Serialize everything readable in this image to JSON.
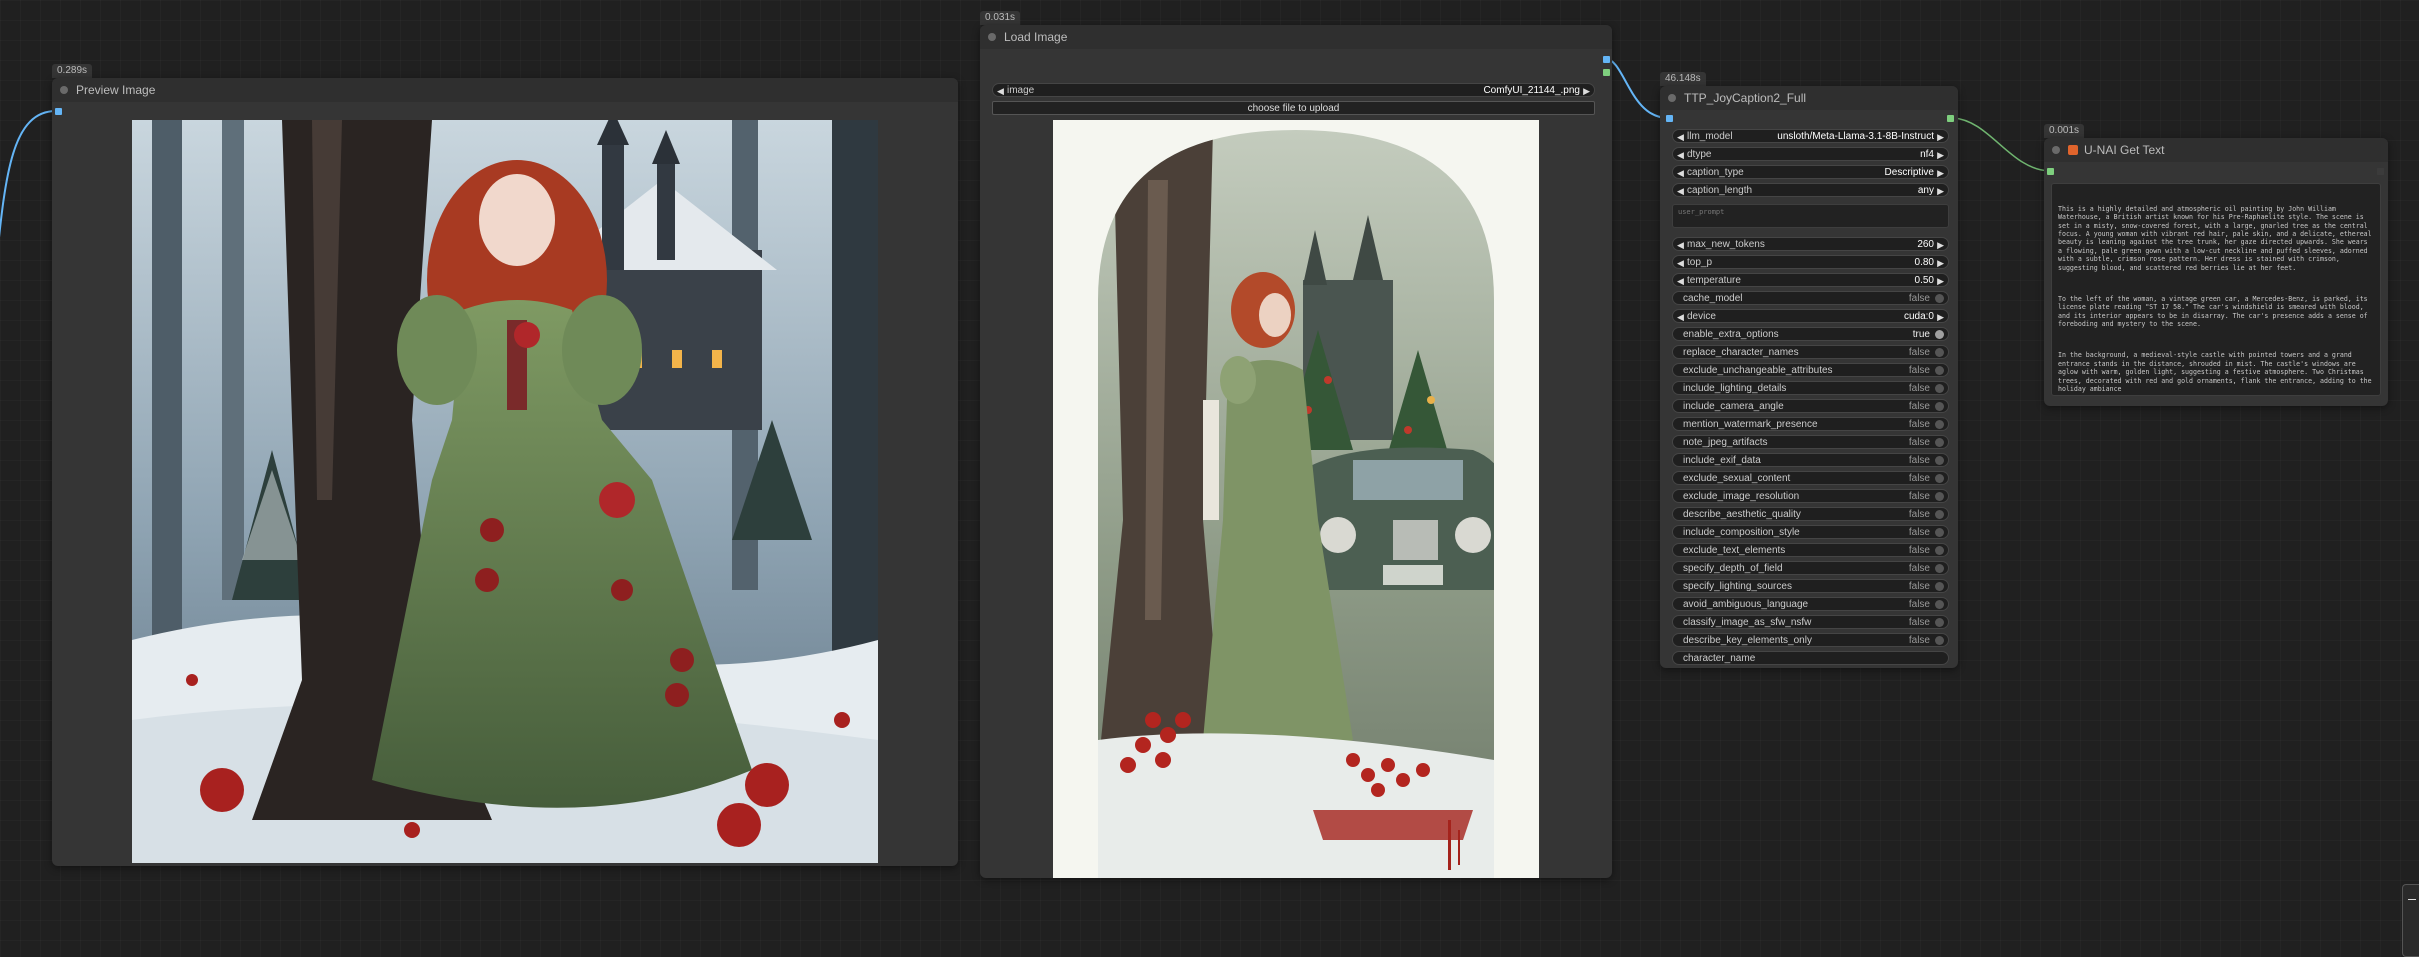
{
  "colors": {
    "canvas": "#202020",
    "node_bg": "#353535",
    "wire_image": "#64b5f6",
    "wire_string": "#7ecf7e"
  },
  "preview_node": {
    "timing": "0.289s",
    "title": "Preview Image"
  },
  "load_node": {
    "timing": "0.031s",
    "title": "Load Image",
    "image_label": "image",
    "image_value": "ComfyUI_21144_.png",
    "upload_label": "choose file to upload"
  },
  "caption_node": {
    "timing": "46.148s",
    "title": "TTP_JoyCaption2_Full",
    "combos": [
      {
        "label": "llm_model",
        "value": "unsloth/Meta-Llama-3.1-8B-Instruct"
      },
      {
        "label": "dtype",
        "value": "nf4"
      },
      {
        "label": "caption_type",
        "value": "Descriptive"
      },
      {
        "label": "caption_length",
        "value": "any"
      }
    ],
    "user_prompt_placeholder": "user_prompt",
    "numbers": [
      {
        "label": "max_new_tokens",
        "value": "260"
      },
      {
        "label": "top_p",
        "value": "0.80"
      },
      {
        "label": "temperature",
        "value": "0.50"
      }
    ],
    "cache_model": {
      "label": "cache_model",
      "value": "false"
    },
    "device": {
      "label": "device",
      "value": "cuda:0"
    },
    "toggles": [
      {
        "label": "enable_extra_options",
        "value": "true"
      },
      {
        "label": "replace_character_names",
        "value": "false"
      },
      {
        "label": "exclude_unchangeable_attributes",
        "value": "false"
      },
      {
        "label": "include_lighting_details",
        "value": "false"
      },
      {
        "label": "include_camera_angle",
        "value": "false"
      },
      {
        "label": "mention_watermark_presence",
        "value": "false"
      },
      {
        "label": "note_jpeg_artifacts",
        "value": "false"
      },
      {
        "label": "include_exif_data",
        "value": "false"
      },
      {
        "label": "exclude_sexual_content",
        "value": "false"
      },
      {
        "label": "exclude_image_resolution",
        "value": "false"
      },
      {
        "label": "describe_aesthetic_quality",
        "value": "false"
      },
      {
        "label": "include_composition_style",
        "value": "false"
      },
      {
        "label": "exclude_text_elements",
        "value": "false"
      },
      {
        "label": "specify_depth_of_field",
        "value": "false"
      },
      {
        "label": "specify_lighting_sources",
        "value": "false"
      },
      {
        "label": "avoid_ambiguous_language",
        "value": "false"
      },
      {
        "label": "classify_image_as_sfw_nsfw",
        "value": "false"
      },
      {
        "label": "describe_key_elements_only",
        "value": "false"
      }
    ],
    "character_name": {
      "label": "character_name"
    }
  },
  "text_node": {
    "timing": "0.001s",
    "title": "U-NAI Get Text",
    "paragraphs": [
      "This is a highly detailed and atmospheric oil painting by John William Waterhouse, a British artist known for his Pre-Raphaelite style. The scene is set in a misty, snow-covered forest, with a large, gnarled tree as the central focus. A young woman with vibrant red hair, pale skin, and a delicate, ethereal beauty is leaning against the tree trunk, her gaze directed upwards. She wears a flowing, pale green gown with a low-cut neckline and puffed sleeves, adorned with a subtle, crimson rose pattern. Her dress is stained with crimson, suggesting blood, and scattered red berries lie at her feet.",
      "To the left of the woman, a vintage green car, a Mercedes-Benz, is parked, its license plate reading \"ST 17 58.\" The car's windshield is smeared with blood, and its interior appears to be in disarray. The car's presence adds a sense of foreboding and mystery to the scene.",
      "In the background, a medieval-style castle with pointed towers and a grand entrance stands in the distance, shrouded in mist. The castle's windows are aglow with warm, golden light, suggesting a festive atmosphere. Two Christmas trees, decorated with red and gold ornaments, flank the entrance, adding to the holiday ambiance"
    ]
  }
}
